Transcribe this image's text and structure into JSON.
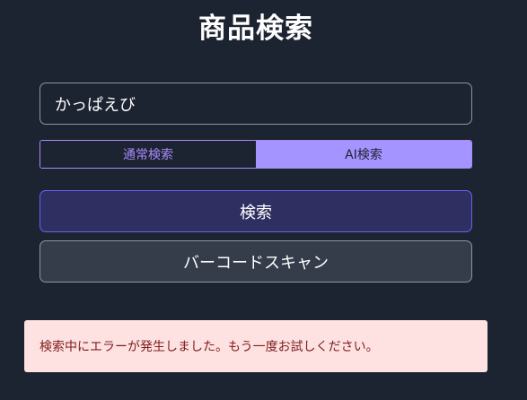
{
  "header": {
    "title": "商品検索"
  },
  "search": {
    "value": "かっぱえび",
    "placeholder": ""
  },
  "mode_toggle": {
    "tabs": [
      {
        "label": "通常検索",
        "selected": false
      },
      {
        "label": "AI検索",
        "selected": true
      }
    ]
  },
  "buttons": {
    "search_label": "検索",
    "barcode_label": "バーコードスキャン"
  },
  "error": {
    "message": "検索中にエラーが発生しました。もう一度お試しください。"
  },
  "colors": {
    "background": "#1c2331",
    "accent": "#a78bfa",
    "active_tab": "#a494ff",
    "search_button": "#2f2f61",
    "barcode_button": "#353c4a",
    "error_background": "#fee2e2",
    "error_text": "#7f1d1d"
  }
}
